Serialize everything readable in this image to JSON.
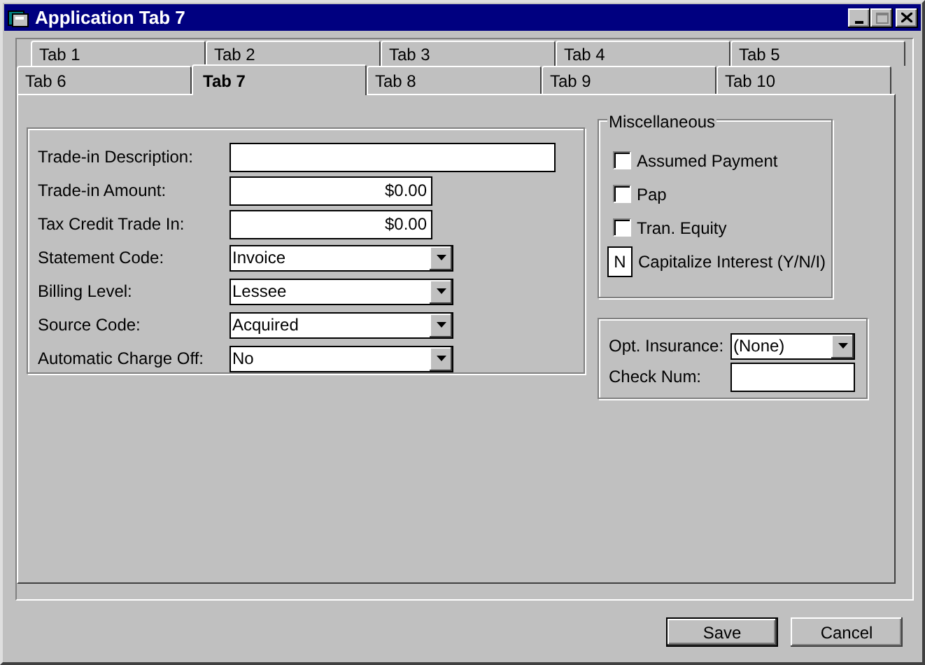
{
  "window": {
    "title": "Application Tab 7"
  },
  "tab_rows": [
    [
      {
        "label": "Tab 1",
        "selected": false
      },
      {
        "label": "Tab 2",
        "selected": false
      },
      {
        "label": "Tab 3",
        "selected": false
      },
      {
        "label": "Tab 4",
        "selected": false
      },
      {
        "label": "Tab 5",
        "selected": false
      }
    ],
    [
      {
        "label": "Tab 6",
        "selected": false
      },
      {
        "label": "Tab 7",
        "selected": true
      },
      {
        "label": "Tab 8",
        "selected": false
      },
      {
        "label": "Tab 9",
        "selected": false
      },
      {
        "label": "Tab 10",
        "selected": false
      }
    ]
  ],
  "trade_in": {
    "fields": [
      {
        "label": "Trade-in Description:",
        "kind": "text"
      },
      {
        "label": "Trade-in Amount:",
        "kind": "amount",
        "value": "$0.00"
      },
      {
        "label": "Tax Credit Trade In:",
        "kind": "amount",
        "value": "$0.00"
      },
      {
        "label": "Statement Code:",
        "kind": "combo",
        "value": "Invoice"
      },
      {
        "label": "Billing Level:",
        "kind": "combo",
        "value": "Lessee"
      },
      {
        "label": "Source Code:",
        "kind": "combo",
        "value": "Acquired"
      },
      {
        "label": "Automatic Charge Off:",
        "kind": "combo",
        "value": "No"
      }
    ]
  },
  "miscellaneous": {
    "title": "Miscellaneous",
    "checkboxes": [
      {
        "label": "Assumed Payment",
        "checked": false
      },
      {
        "label": "Pap",
        "checked": false
      },
      {
        "label": "Tran. Equity",
        "checked": false
      }
    ],
    "capitalize_interest": {
      "value": "N",
      "label": "Capitalize Interest (Y/N/I)"
    }
  },
  "insurance": {
    "fields": [
      {
        "label": "Opt. Insurance:",
        "kind": "combo",
        "value": "(None)"
      },
      {
        "label": "Check Num:",
        "kind": "text"
      }
    ]
  },
  "buttons": [
    {
      "label": "Save",
      "default": true
    },
    {
      "label": "Cancel",
      "default": false
    }
  ]
}
